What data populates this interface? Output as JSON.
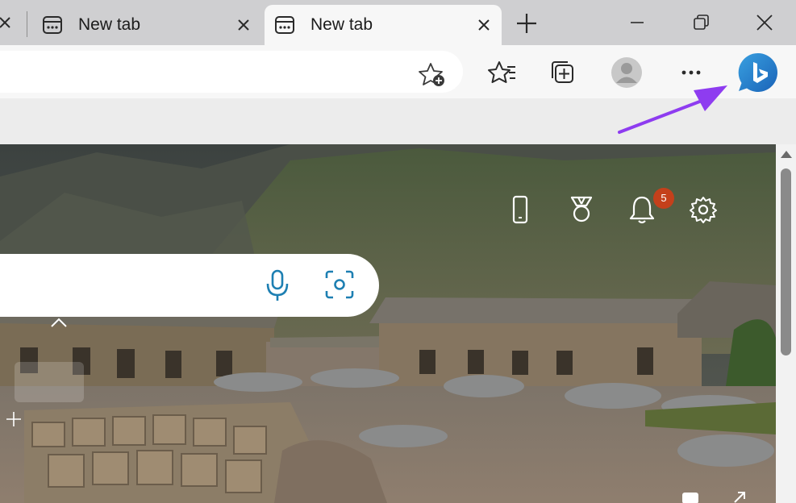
{
  "tabs": [
    {
      "title": "New tab",
      "active": false
    },
    {
      "title": "New tab",
      "active": true
    }
  ],
  "toolbar": {
    "favorites_add_icon": "star-plus-icon",
    "buttons": [
      "favorites-icon",
      "collections-icon",
      "profile-icon",
      "more-icon",
      "bing-chat-icon"
    ]
  },
  "page": {
    "notification_count": "5",
    "top_icons": [
      "phone-icon",
      "rewards-icon",
      "bell-icon",
      "settings-icon"
    ],
    "search_icons": [
      "microphone-icon",
      "visual-search-icon"
    ]
  },
  "colors": {
    "tabstrip": "#cfcfd1",
    "active_tab": "#f7f7f7",
    "accent_blue": "#1d7fb2",
    "badge": "#c4401b",
    "arrow": "#8e3cf0"
  }
}
